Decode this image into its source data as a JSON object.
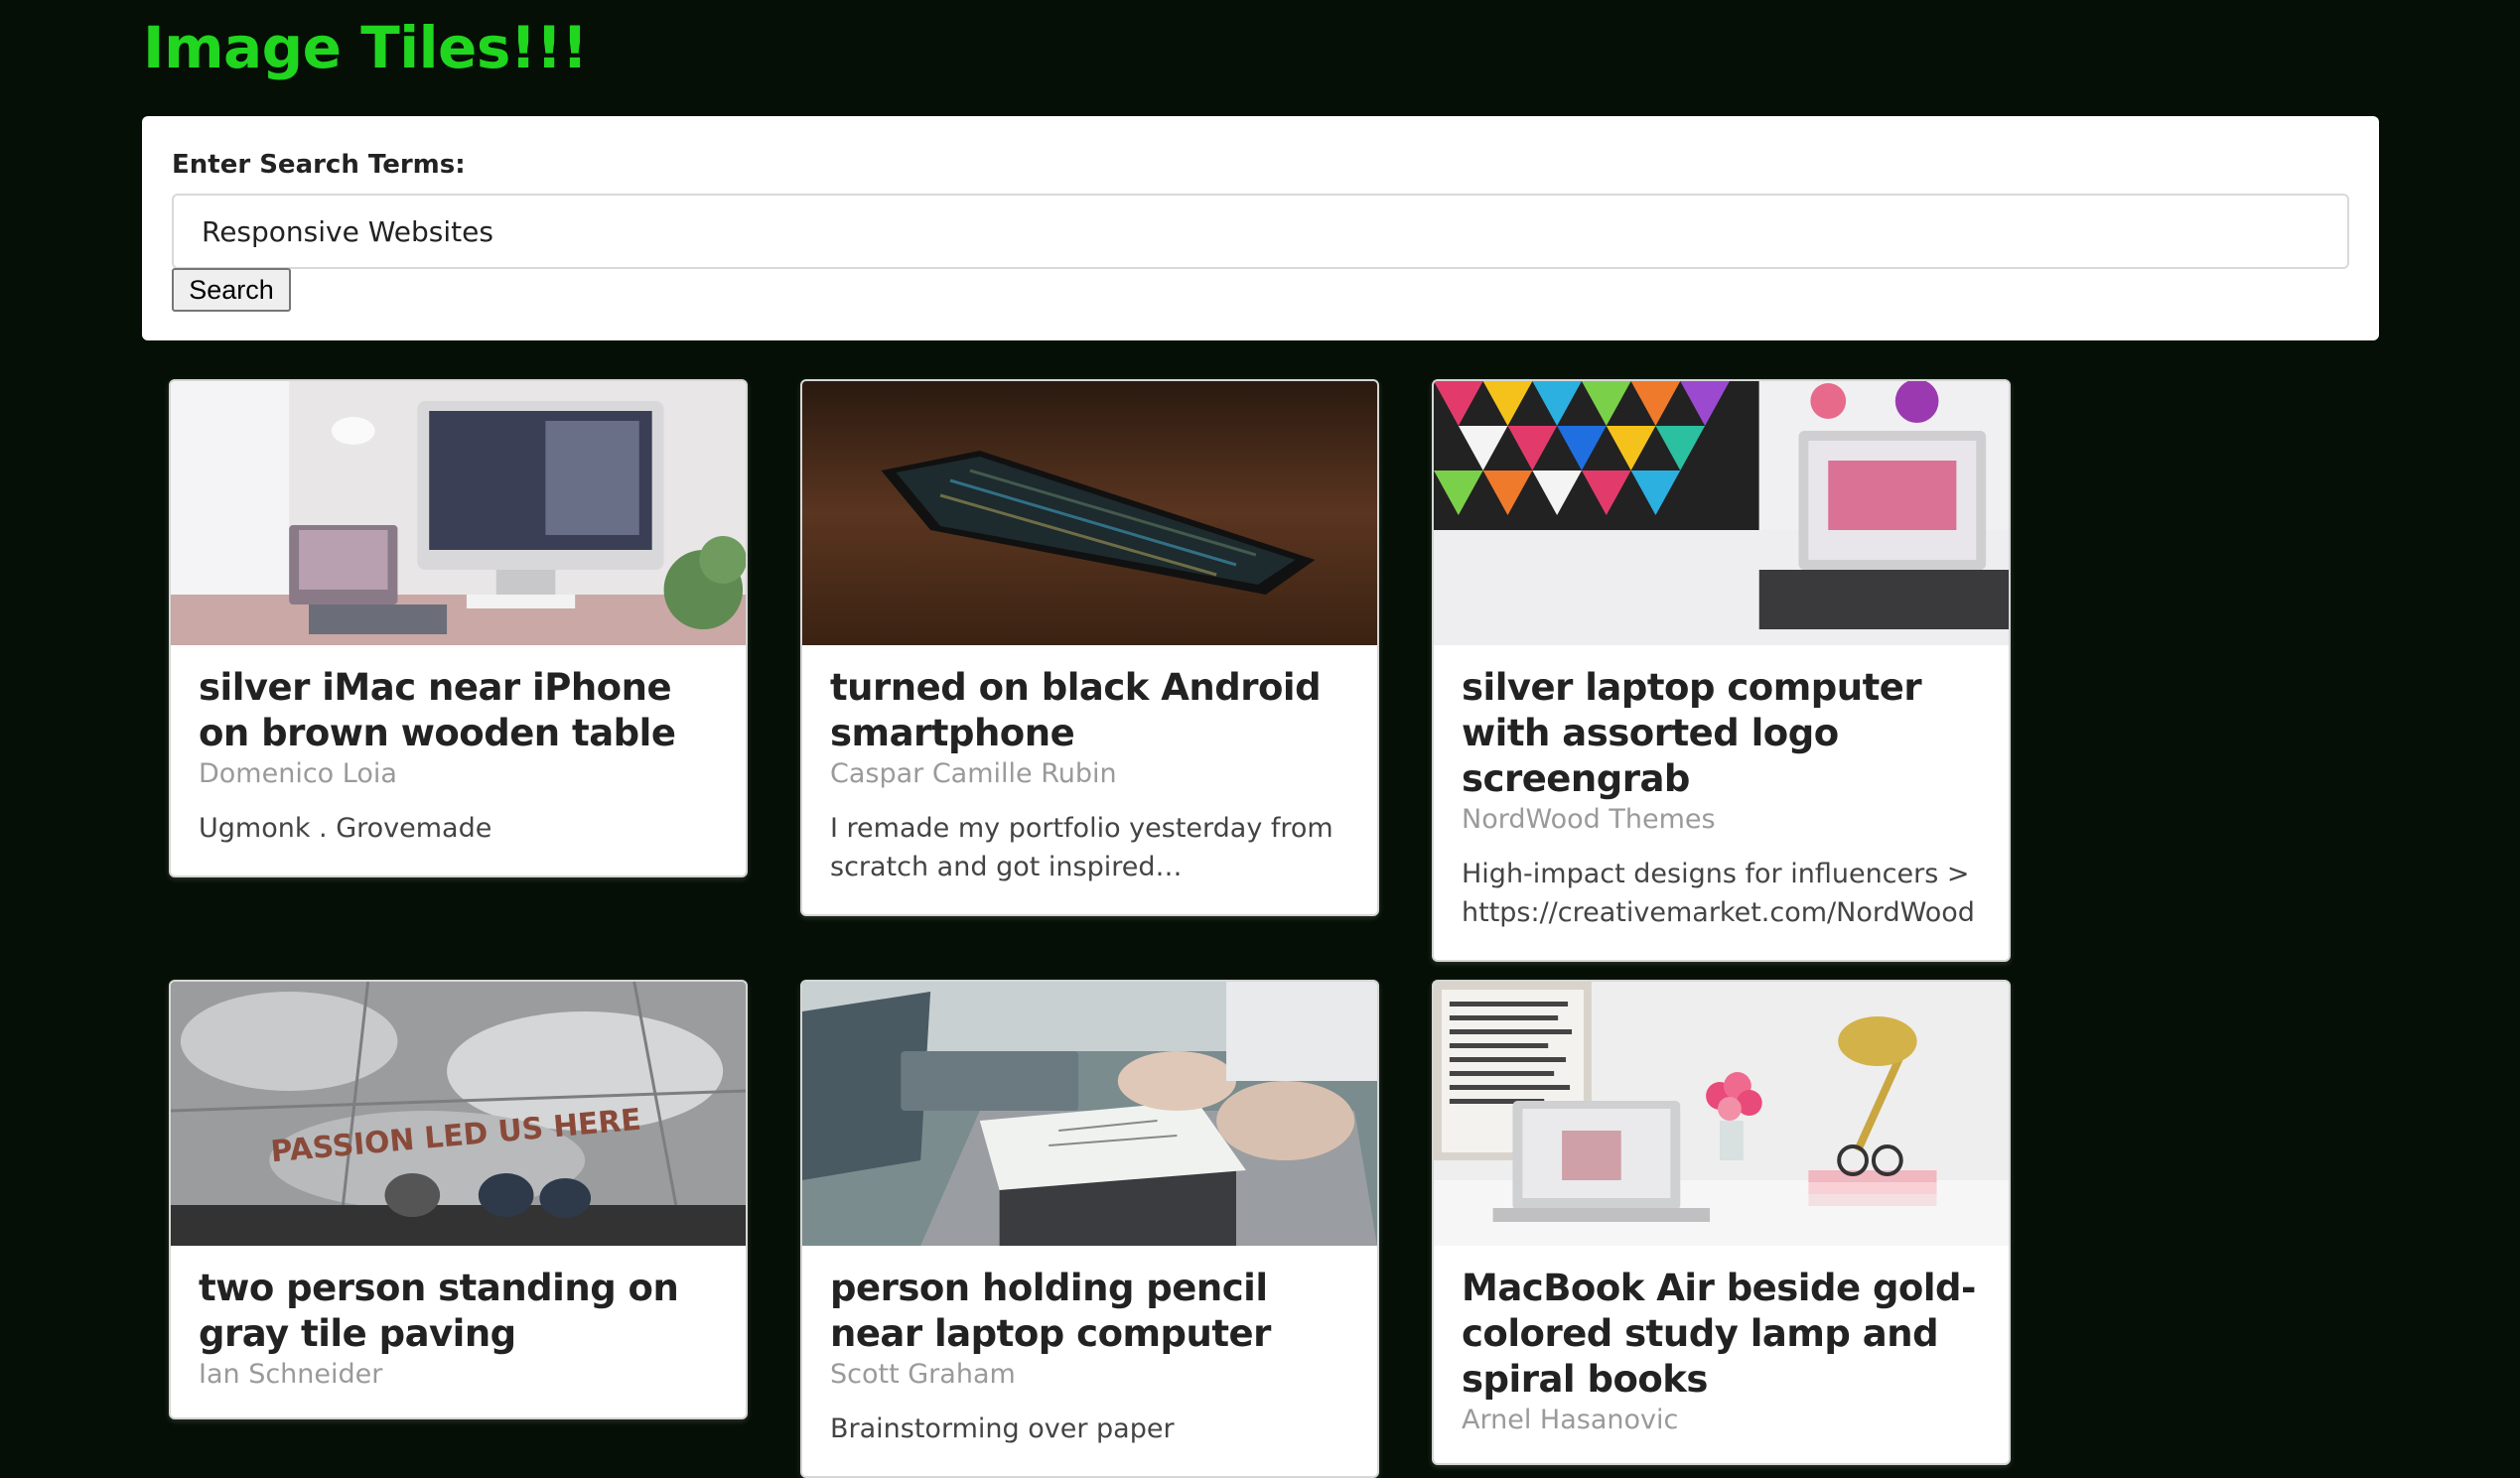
{
  "header": {
    "title": "Image Tiles!!!"
  },
  "search": {
    "label": "Enter Search Terms:",
    "value": "Responsive Websites",
    "button_label": "Search"
  },
  "colors": {
    "background": "#060f06",
    "title": "#20d61f",
    "card": "#ffffff",
    "author": "#9a9a9a"
  },
  "cards": [
    {
      "title": "silver iMac near iPhone on brown wooden table",
      "author": "Domenico Loia",
      "description": "Ugmonk . Grovemade"
    },
    {
      "title": "turned on black Android smartphone",
      "author": "Caspar Camille Rubin",
      "description": "I remade my portfolio yesterday from scratch and got inspired…"
    },
    {
      "title": "silver laptop computer with assorted logo screengrab",
      "author": "NordWood Themes",
      "description": "High-impact designs for influencers > https://creativemarket.com/NordWood"
    },
    {
      "title": "two person standing on gray tile paving",
      "author": "Ian Schneider",
      "description": "",
      "image_text": "PASSION LED US HERE"
    },
    {
      "title": "person holding pencil near laptop computer",
      "author": "Scott Graham",
      "description": "Brainstorming over paper"
    },
    {
      "title": "MacBook Air beside gold-colored study lamp and spiral books",
      "author": "Arnel Hasanovic",
      "description": ""
    }
  ]
}
